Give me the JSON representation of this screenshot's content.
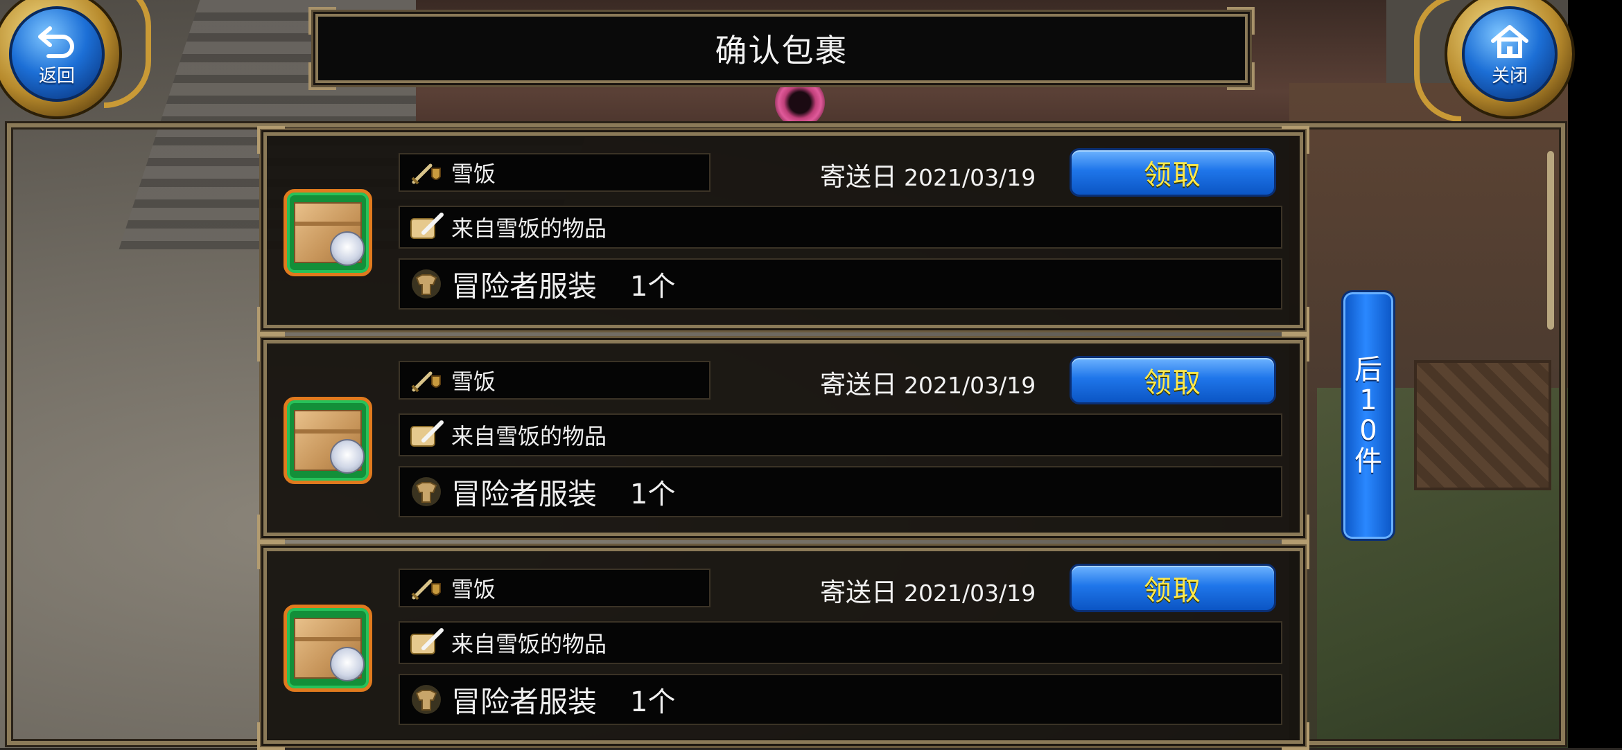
{
  "header": {
    "title": "确认包裹",
    "back_label": "返回",
    "close_label": "关闭"
  },
  "side": {
    "next_page_label": "后10件"
  },
  "packages": [
    {
      "sender": "雪饭",
      "date_prefix": "寄送日",
      "date": "2021/03/19",
      "claim_label": "领取",
      "subject": "来自雪饭的物品",
      "item_name": "冒险者服装",
      "item_qty": "1个"
    },
    {
      "sender": "雪饭",
      "date_prefix": "寄送日",
      "date": "2021/03/19",
      "claim_label": "领取",
      "subject": "来自雪饭的物品",
      "item_name": "冒险者服装",
      "item_qty": "1个"
    },
    {
      "sender": "雪饭",
      "date_prefix": "寄送日",
      "date": "2021/03/19",
      "claim_label": "领取",
      "subject": "来自雪饭的物品",
      "item_name": "冒险者服装",
      "item_qty": "1个"
    }
  ],
  "icons": {
    "back": "return-arrow-icon",
    "close": "home-icon",
    "package": "package-box-icon",
    "sender": "sword-shield-icon",
    "subject": "scroll-quill-icon",
    "item": "armor-clothes-icon"
  },
  "colors": {
    "claim_button": "#1f76ea",
    "claim_text": "#ffe94a",
    "frame_gold": "#8b7a58",
    "package_bg": "#138f39"
  }
}
